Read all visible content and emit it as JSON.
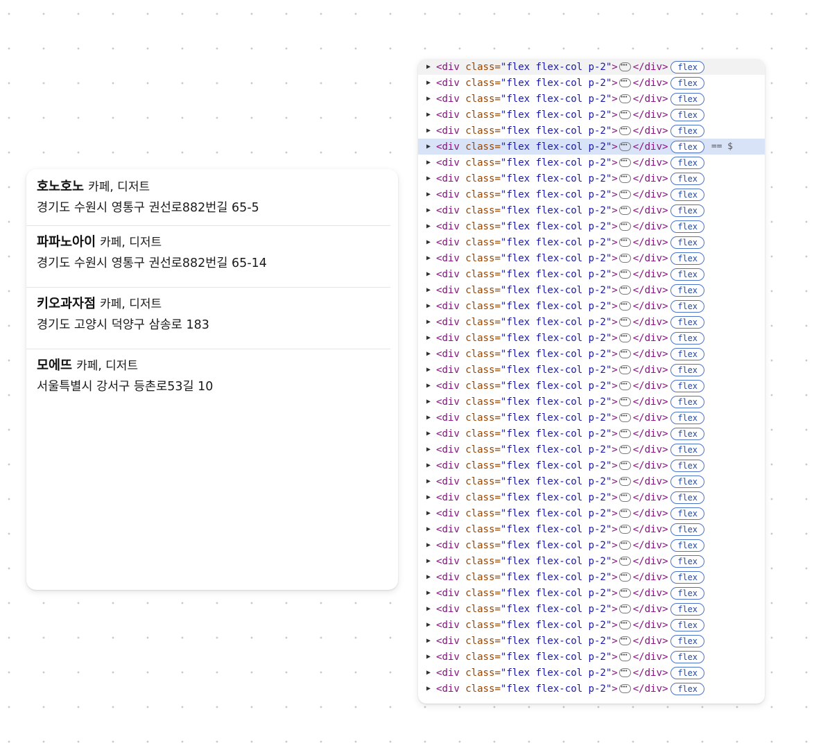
{
  "places": [
    {
      "name": "호노호노",
      "category": "카페, 디저트",
      "address": "경기도 수원시 영통구 권선로882번길 65-5"
    },
    {
      "name": "파파노아이",
      "category": "카페, 디저트",
      "address": "경기도 수원시 영통구 권선로882번길 65-14"
    },
    {
      "name": "키오과자점",
      "category": "카페, 디저트",
      "address": "경기도 고양시 덕양구 삼송로 183"
    },
    {
      "name": "모에뜨",
      "category": "카페, 디저트",
      "address": "서울특별시 강서구 등촌로53길 10"
    }
  ],
  "devtools": {
    "row": {
      "open_tag": "<div",
      "attr_name": "class=",
      "attr_value": "\"flex flex-col p-2\"",
      "close_bracket": ">",
      "end_tag": "</div>",
      "badge": "flex"
    },
    "visible_row_count": 40,
    "selected_row_index": 5,
    "console_ref": "== $"
  }
}
